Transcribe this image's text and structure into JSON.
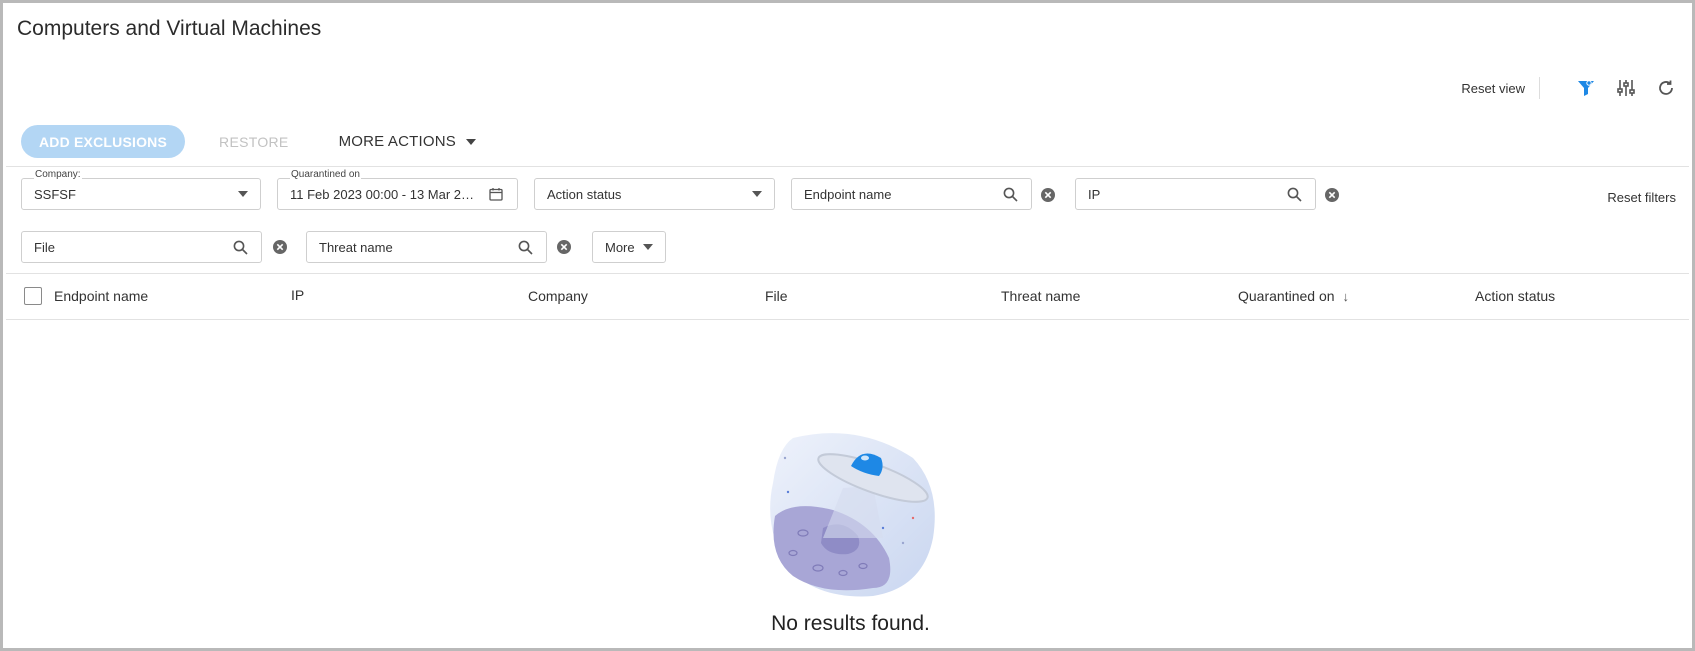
{
  "page": {
    "title": "Computers and Virtual Machines"
  },
  "toolbar": {
    "reset_view": "Reset view",
    "icons": [
      "filter-icon",
      "column-settings-icon",
      "refresh-icon"
    ]
  },
  "actions": {
    "add_exclusions": "ADD EXCLUSIONS",
    "restore": "RESTORE",
    "more_actions": "MORE ACTIONS"
  },
  "filters": {
    "company": {
      "label": "Company:",
      "value": "SSFSF"
    },
    "quarantined_on": {
      "label": "Quarantined on",
      "value": "11 Feb 2023 00:00 - 13 Mar 2023 1..."
    },
    "action_status": {
      "placeholder": "Action status"
    },
    "endpoint_name": {
      "placeholder": "Endpoint name"
    },
    "ip": {
      "placeholder": "IP"
    },
    "file": {
      "placeholder": "File"
    },
    "threat_name": {
      "placeholder": "Threat name"
    },
    "more": "More",
    "reset_filters": "Reset filters"
  },
  "table": {
    "columns": [
      "Endpoint name",
      "IP",
      "Company",
      "File",
      "Threat name",
      "Quarantined on",
      "Action status"
    ],
    "sort_indicator": "↓",
    "empty_message": "No results found."
  },
  "colors": {
    "accent": "#1e88e5",
    "primary_disabled": "#b3d6f4"
  }
}
